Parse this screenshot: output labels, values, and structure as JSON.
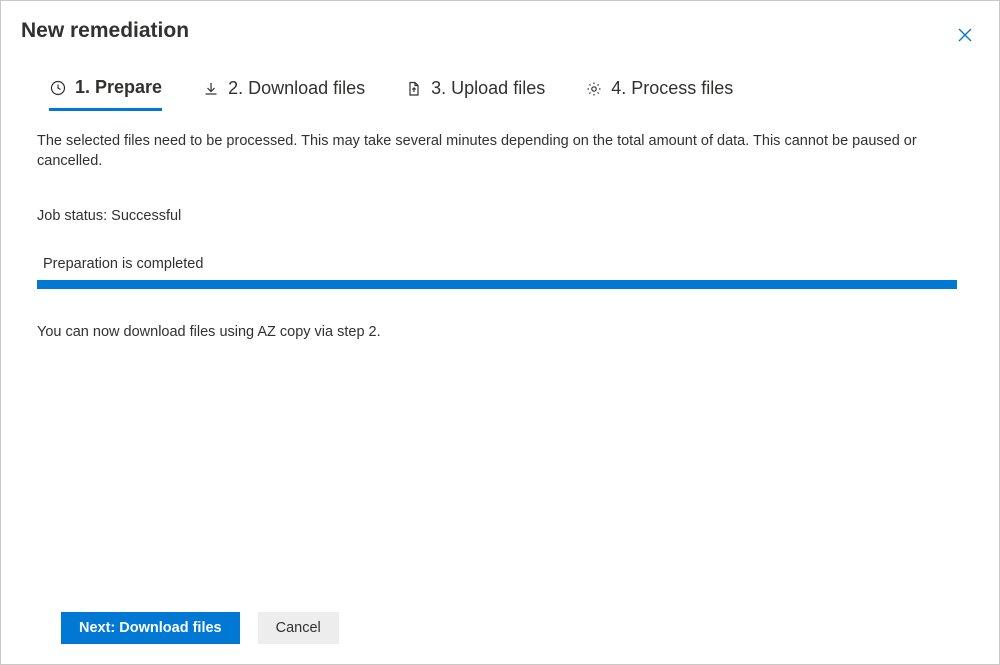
{
  "title": "New remediation",
  "tabs": {
    "prepare": "1. Prepare",
    "download": "2. Download files",
    "upload": "3. Upload files",
    "process": "4. Process files"
  },
  "content": {
    "description": "The selected files need to be processed. This may take several minutes depending on the total amount of data. This cannot be paused or cancelled.",
    "job_status": "Job status: Successful",
    "progress_label": "Preparation is completed",
    "hint": "You can now download files using AZ copy via step 2.",
    "progress_percent": 100
  },
  "buttons": {
    "next": "Next: Download files",
    "cancel": "Cancel"
  },
  "colors": {
    "accent": "#0078d4"
  }
}
